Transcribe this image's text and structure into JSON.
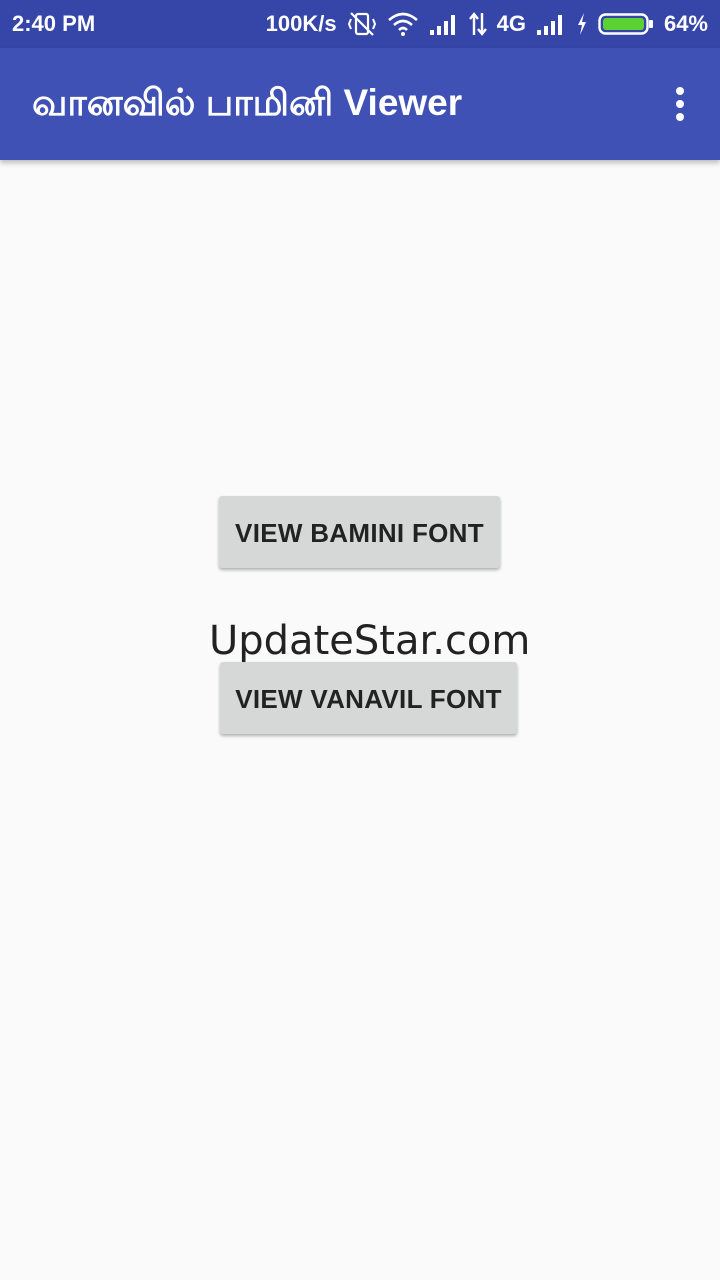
{
  "status_bar": {
    "time": "2:40 PM",
    "network_speed": "100K/s",
    "network_type": "4G",
    "battery": "64%",
    "battery_level": 0.64,
    "icons": [
      "vibrate-off-icon",
      "wifi-icon",
      "signal-icon",
      "data-arrows-icon",
      "signal-icon",
      "charging-icon",
      "battery-icon"
    ]
  },
  "app_bar": {
    "title": "வானவில் பாமினி Viewer",
    "menu_icon": "more-vert-icon",
    "color": "#3f51b5",
    "status_color": "#3545a8"
  },
  "main": {
    "bamini_button": "VIEW BAMINI FONT",
    "vanavil_button": "VIEW VANAVIL FONT",
    "watermark": "UpdateStar.com"
  }
}
